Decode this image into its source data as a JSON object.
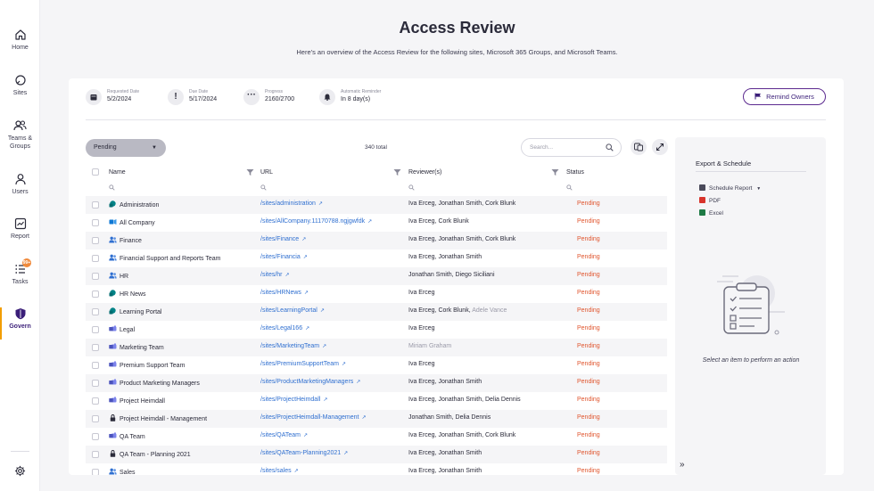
{
  "nav": {
    "items": [
      {
        "label": "Home",
        "icon": "home-icon"
      },
      {
        "label": "Sites",
        "icon": "globe-icon"
      },
      {
        "label": "Teams &",
        "label2": "Groups",
        "icon": "people-icon"
      },
      {
        "label": "Users",
        "icon": "user-icon"
      },
      {
        "label": "Report",
        "icon": "report-icon"
      },
      {
        "label": "Tasks",
        "icon": "tasks-icon",
        "badge": "99+"
      },
      {
        "label": "Govern",
        "icon": "shield-icon",
        "active": true
      }
    ],
    "settings_icon": "gear-icon"
  },
  "header": {
    "title": "Access Review",
    "subtitle": "Here's an overview of the Access Review for the following sites, Microsoft 365 Groups, and Microsoft Teams."
  },
  "meta": {
    "requested": {
      "label": "Requested Date",
      "value": "5/2/2024",
      "icon": "calendar-icon"
    },
    "due": {
      "label": "Due Date",
      "value": "5/17/2024",
      "icon": "exclamation-icon"
    },
    "progress": {
      "label": "Progress",
      "value": "2160/2700",
      "icon": "ellipsis-icon"
    },
    "reminder": {
      "label": "Automatic Reminder",
      "value": "In 8 day(s)",
      "icon": "bell-icon"
    }
  },
  "remind_button": "Remind Owners",
  "toolbar": {
    "status_filter": "Pending",
    "total": "340 total",
    "search_placeholder": "Search..."
  },
  "table": {
    "columns": {
      "name": "Name",
      "url": "URL",
      "reviewers": "Reviewer(s)",
      "status": "Status"
    },
    "rows": [
      {
        "name": "Administration",
        "type": "site",
        "url": "/sites/administration",
        "reviewers": "Iva Erceg, Jonathan Smith, Cork Blunk",
        "extra": "",
        "status": "Pending"
      },
      {
        "name": "All Company",
        "type": "group",
        "url": "/sites/AllCompany.11170788.ngjgwfdk",
        "reviewers": "Iva Erceg, Cork Blunk",
        "extra": "",
        "status": "Pending"
      },
      {
        "name": "Finance",
        "type": "people",
        "url": "/sites/Finance",
        "reviewers": "Iva Erceg, Jonathan Smith, Cork Blunk",
        "extra": "",
        "status": "Pending"
      },
      {
        "name": "Financial Support and Reports Team",
        "type": "people",
        "url": "/sites/Financia",
        "reviewers": "Iva Erceg, Jonathan Smith",
        "extra": "",
        "status": "Pending"
      },
      {
        "name": "HR",
        "type": "people",
        "url": "/sites/hr",
        "reviewers": "Jonathan Smith, Diego Siciliani",
        "extra": "",
        "status": "Pending"
      },
      {
        "name": "HR News",
        "type": "site",
        "url": "/sites/HRNews",
        "reviewers": "Iva Erceg",
        "extra": "",
        "status": "Pending"
      },
      {
        "name": "Learning Portal",
        "type": "site",
        "url": "/sites/LearningPortal",
        "reviewers": "Iva Erceg, Cork Blunk,",
        "extra": "Adele Vance",
        "status": "Pending"
      },
      {
        "name": "Legal",
        "type": "teams",
        "url": "/sites/Legal166",
        "reviewers": "Iva Erceg",
        "extra": "",
        "status": "Pending"
      },
      {
        "name": "Marketing Team",
        "type": "teams",
        "url": "/sites/MarketingTeam",
        "reviewers": "",
        "extra": "Miriam Graham",
        "status": "Pending"
      },
      {
        "name": "Premium Support Team",
        "type": "teams",
        "url": "/sites/PremiumSupportTeam",
        "reviewers": "Iva Erceg",
        "extra": "",
        "status": "Pending"
      },
      {
        "name": "Product Marketing Managers",
        "type": "teams",
        "url": "/sites/ProductMarketingManagers",
        "reviewers": "Iva Erceg, Jonathan Smith",
        "extra": "",
        "status": "Pending"
      },
      {
        "name": "Project Heimdall",
        "type": "teams",
        "url": "/sites/ProjectHeimdall",
        "reviewers": "Iva Erceg, Jonathan Smith, Delia Dennis",
        "extra": "",
        "status": "Pending"
      },
      {
        "name": "Project Heimdall - Management",
        "type": "lock",
        "url": "/sites/ProjectHeimdall-Management",
        "reviewers": "Jonathan Smith, Delia Dennis",
        "extra": "",
        "status": "Pending"
      },
      {
        "name": "QA Team",
        "type": "teams",
        "url": "/sites/QATeam",
        "reviewers": "Iva Erceg, Jonathan Smith, Cork Blunk",
        "extra": "",
        "status": "Pending"
      },
      {
        "name": "QA Team - Planning 2021",
        "type": "lock",
        "url": "/sites/QATeam-Planning2021",
        "reviewers": "Iva Erceg, Jonathan Smith",
        "extra": "",
        "status": "Pending"
      },
      {
        "name": "Sales",
        "type": "people",
        "url": "/sites/sales",
        "reviewers": "Iva Erceg, Jonathan Smith",
        "extra": "",
        "status": "Pending"
      }
    ]
  },
  "panel": {
    "title": "Export & Schedule",
    "schedule_report": "Schedule Report",
    "pdf": "PDF",
    "excel": "Excel",
    "empty_text": "Select an item to perform an action"
  },
  "colors": {
    "accent": "#3a1e78",
    "status_pending": "#e0562f",
    "link": "#2f6fd0",
    "active_bar": "#f29d00"
  }
}
